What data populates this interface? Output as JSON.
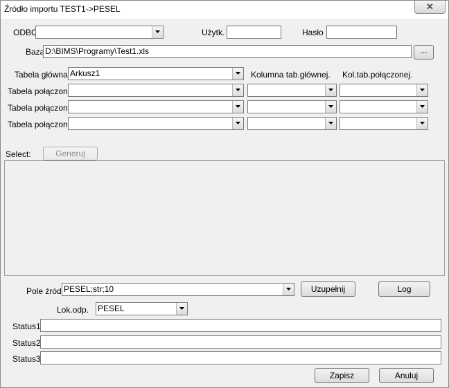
{
  "window": {
    "title": "Źródło importu TEST1->PESEL",
    "close_glyph": "✕"
  },
  "connection": {
    "odbc_label": "ODBC",
    "odbc_value": "",
    "user_label": "Użytk.",
    "user_value": "",
    "password_label": "Hasło",
    "password_value": "",
    "database_label": "Baza",
    "database_value": "D:\\BIMS\\Programy\\Test1.xls",
    "browse_label": "..."
  },
  "tables": {
    "main_table_label": "Tabela główna",
    "main_table_value": "Arkusz1",
    "main_column_header": "Kolumna tab.głównej.",
    "joined_column_header": "Kol.tab.połączonej.",
    "joined_label": "Tabela połączona",
    "joined_rows": [
      {
        "table": "",
        "main_col": "",
        "joined_col": ""
      },
      {
        "table": "",
        "main_col": "",
        "joined_col": ""
      },
      {
        "table": "",
        "main_col": "",
        "joined_col": ""
      }
    ]
  },
  "select": {
    "label": "Select:",
    "generate_label": "Generuj",
    "sql": ""
  },
  "source": {
    "field_label": "Pole źródł",
    "field_value": "PESEL;str;10",
    "complete_label": "Uzupełnij",
    "log_label": "Log",
    "lok_label": "Lok.odp.",
    "lok_value": "PESEL"
  },
  "status": [
    {
      "label": "Status1",
      "value": ""
    },
    {
      "label": "Status2",
      "value": ""
    },
    {
      "label": "Status3",
      "value": ""
    }
  ],
  "footer": {
    "save_label": "Zapisz",
    "cancel_label": "Anuluj"
  },
  "colors": {
    "dialog_bg": "#f0f0f0",
    "title_bg": "#ffffff",
    "field_border": "#7a7a7a"
  }
}
